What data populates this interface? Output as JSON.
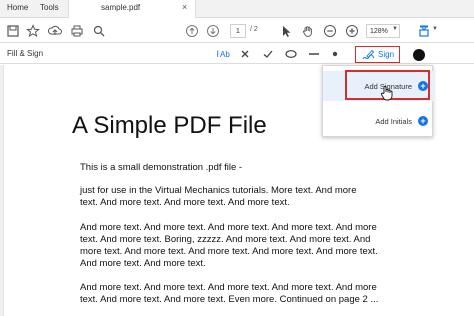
{
  "app": {
    "nav": {
      "home": "Home",
      "tools": "Tools"
    },
    "document_tab": {
      "label": "sample.pdf",
      "close_glyph": "×"
    }
  },
  "toolbar": {
    "icons": [
      "save-icon",
      "star-icon",
      "upload-icon",
      "print-icon",
      "search-icon",
      "page-up-icon",
      "page-down-icon",
      "select-cursor-icon",
      "hand-icon",
      "zoom-out-icon",
      "zoom-in-icon",
      "fit-page-icon"
    ],
    "page_current": "1",
    "page_total": "/ 2",
    "zoom": "128%"
  },
  "fill_sign": {
    "title": "Fill & Sign",
    "tools": [
      "text-tool-icon",
      "cross-mark-icon",
      "check-mark-icon",
      "ellipse-icon",
      "line-icon",
      "dot-icon"
    ],
    "sign_label": "Sign",
    "color": "#111111"
  },
  "sign_menu": {
    "add_signature": "Add Signature",
    "add_initials": "Add Initials"
  },
  "pdf": {
    "title": "A Simple PDF File",
    "lines": [
      "This is a small demonstration .pdf file -",
      "just for use in the Virtual Mechanics tutorials. More text. And more",
      "text. And more text. And more text. And more text.",
      "And more text. And more text. And more text. And more text. And more",
      "text. And more text. Boring, zzzzz. And more text. And more text. And",
      "more text. And more text. And more text. And more text. And more text.",
      "And more text. And more text.",
      "And more text. And more text. And more text. And more text. And more",
      "text. And more text. And more text. Even more. Continued on page 2 ..."
    ]
  },
  "colors": {
    "accent": "#1473e6",
    "highlight_border": "#d32f2f",
    "menu_highlight": "#e7f0fb"
  }
}
